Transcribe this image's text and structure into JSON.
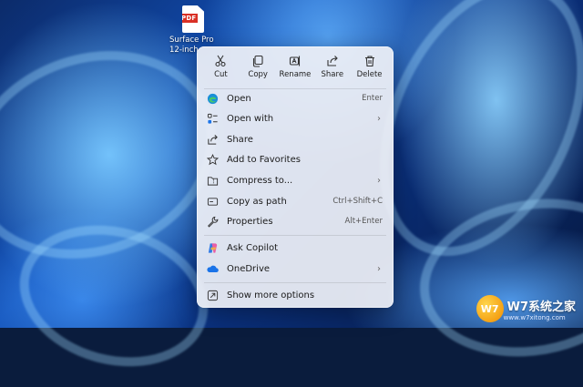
{
  "desktop": {
    "file": {
      "badge": "PDF",
      "name": "Surface Pro\n12-inch"
    }
  },
  "toolbar": [
    {
      "label": "Cut",
      "icon": "cut-icon"
    },
    {
      "label": "Copy",
      "icon": "copy-icon"
    },
    {
      "label": "Rename",
      "icon": "rename-icon"
    },
    {
      "label": "Share",
      "icon": "share-icon"
    },
    {
      "label": "Delete",
      "icon": "delete-icon"
    }
  ],
  "menu": {
    "items": [
      {
        "label": "Open",
        "shortcut": "Enter",
        "icon": "edge-icon"
      },
      {
        "label": "Open with",
        "submenu": "›",
        "icon": "open-with-icon"
      },
      {
        "label": "Share",
        "icon": "share-icon"
      },
      {
        "label": "Add to Favorites",
        "icon": "star-icon"
      },
      {
        "label": "Compress to...",
        "submenu": "›",
        "icon": "zip-folder-icon"
      },
      {
        "label": "Copy as path",
        "shortcut": "Ctrl+Shift+C",
        "icon": "path-icon"
      },
      {
        "label": "Properties",
        "shortcut": "Alt+Enter",
        "icon": "wrench-icon"
      },
      {
        "label": "Ask Copilot",
        "icon": "copilot-icon"
      },
      {
        "label": "OneDrive",
        "submenu": "›",
        "icon": "onedrive-icon"
      },
      {
        "label": "Show more options",
        "icon": "more-options-icon"
      }
    ]
  },
  "watermark": {
    "logo": "W7",
    "text": "W7系统之家",
    "sub": "www.w7xitong.com"
  },
  "colors": {
    "menu_bg": "#eef0f6",
    "accent": "#1a73e8",
    "pdf_badge": "#d93025"
  }
}
